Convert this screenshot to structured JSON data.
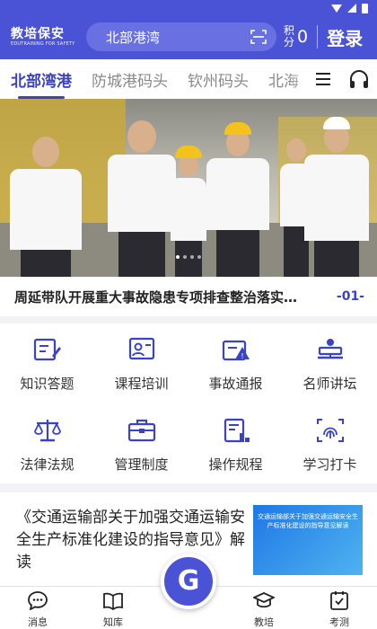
{
  "header": {
    "logo_text": "教培保安",
    "logo_subtitle": "EDUTRAINING FOR SAFETY",
    "search_value": "北部港湾",
    "points_label": "积分",
    "points_value": "0",
    "login_label": "登录",
    "accent_color": "#4a52d6"
  },
  "tabs": [
    {
      "label": "北部湾港",
      "active": true
    },
    {
      "label": "防城港码头",
      "active": false
    },
    {
      "label": "钦州码头",
      "active": false
    },
    {
      "label": "北海",
      "active": false
    }
  ],
  "tab_icons": [
    "menu-icon",
    "headset-icon"
  ],
  "banner": {
    "caption": "周延带队开展重大事故隐患专项排查整治落实…",
    "index": "-01-",
    "dot_count": 4,
    "active_dot": 0
  },
  "features": [
    {
      "label": "知识答题",
      "icon": "quiz-icon"
    },
    {
      "label": "课程培训",
      "icon": "course-icon"
    },
    {
      "label": "事故通报",
      "icon": "alert-icon"
    },
    {
      "label": "名师讲坛",
      "icon": "lecture-icon"
    },
    {
      "label": "法律法规",
      "icon": "scale-icon"
    },
    {
      "label": "管理制度",
      "icon": "briefcase-icon"
    },
    {
      "label": "操作规程",
      "icon": "procedure-icon"
    },
    {
      "label": "学习打卡",
      "icon": "fingerprint-icon"
    }
  ],
  "article": {
    "title": "《交通运输部关于加强交通运输安全生产标准化建设的指导意见》解读",
    "thumb_text": "交通运输部关于加强交通运输安全生产标准化建设的指导意见解读"
  },
  "fab_label": "G",
  "bottom_nav": [
    {
      "label": "消息",
      "icon": "message-icon"
    },
    {
      "label": "知库",
      "icon": "book-icon"
    },
    {
      "label": "",
      "icon": ""
    },
    {
      "label": "教培",
      "icon": "graduation-icon"
    },
    {
      "label": "考测",
      "icon": "exam-icon"
    }
  ]
}
